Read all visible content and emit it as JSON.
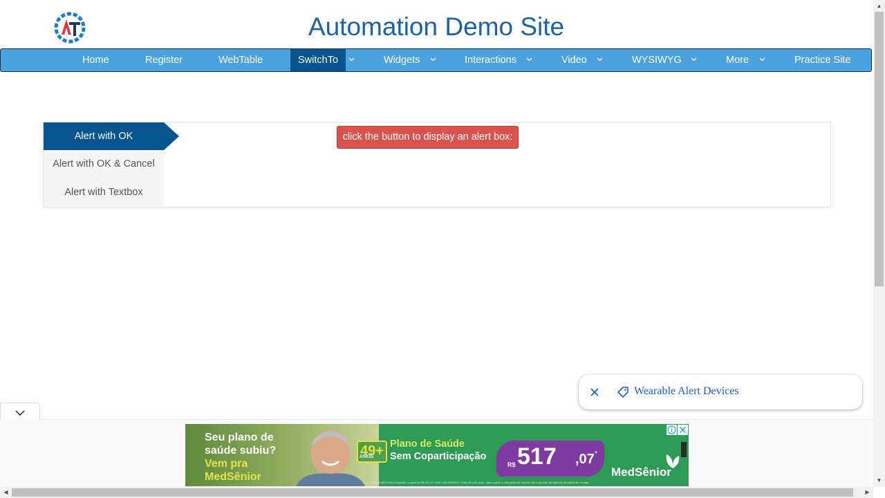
{
  "site": {
    "title": "Automation Demo Site"
  },
  "nav": {
    "items": [
      {
        "label": "Home",
        "dropdown": false
      },
      {
        "label": "Register",
        "dropdown": false
      },
      {
        "label": "WebTable",
        "dropdown": false
      },
      {
        "label": "SwitchTo",
        "dropdown": true,
        "active": true
      },
      {
        "label": "Widgets",
        "dropdown": true
      },
      {
        "label": "Interactions",
        "dropdown": true
      },
      {
        "label": "Video",
        "dropdown": true
      },
      {
        "label": "WYSIWYG",
        "dropdown": true
      },
      {
        "label": "More",
        "dropdown": true
      },
      {
        "label": "Practice Site",
        "dropdown": false
      }
    ]
  },
  "alerts": {
    "tabs": [
      {
        "label": "Alert with OK",
        "active": true
      },
      {
        "label": "Alert with OK & Cancel",
        "active": false
      },
      {
        "label": "Alert with Textbox",
        "active": false
      }
    ],
    "button_label": "click the button to display an alert box:"
  },
  "chip": {
    "label": "Wearable Alert Devices"
  },
  "ad": {
    "headline": "Seu plano de saúde subiu?",
    "cta": "Vem pra MedSênior",
    "age_badge": "49+",
    "age_unit": "ANOS",
    "line1": "Plano de Saúde",
    "line2": "Sem Coparticipação",
    "currency": "R$",
    "price": "517",
    "cents": ",07",
    "cents_mark": "*",
    "brand": "MedSênior",
    "fine_print": "*Plano MED Belo Horizonte, a partir de R$ 517,07. ANS: 492.000/2024. Faixa 49 a 53 anos. Valor sujeito a alterações de acordo com a período de vigência da tabela de vendas."
  },
  "colors": {
    "nav_bg": "#4aa3e0",
    "nav_active": "#07548f",
    "title": "#1d61a6",
    "alert_button": "#d9534f",
    "chip_text": "#1a5fc6"
  }
}
